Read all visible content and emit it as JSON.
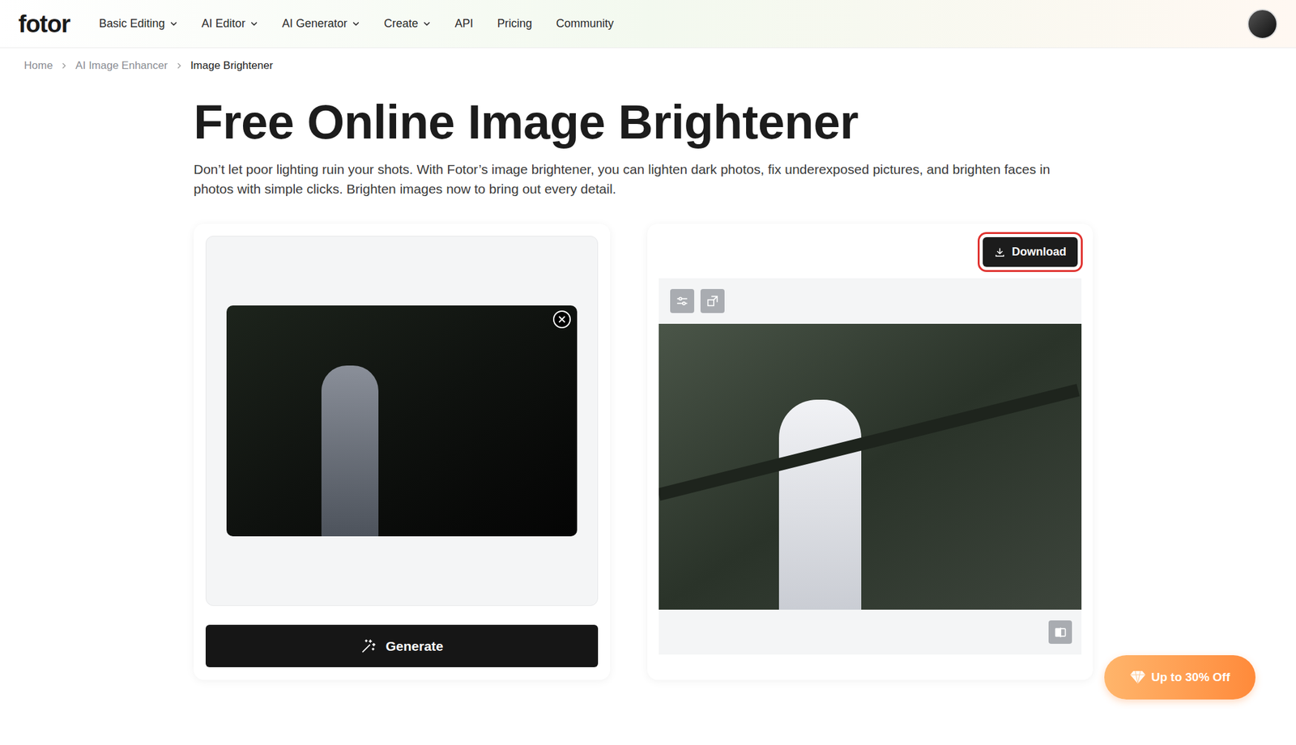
{
  "header": {
    "logo": "fotor",
    "nav": [
      {
        "label": "Basic Editing",
        "dropdown": true
      },
      {
        "label": "AI Editor",
        "dropdown": true
      },
      {
        "label": "AI Generator",
        "dropdown": true
      },
      {
        "label": "Create",
        "dropdown": true
      },
      {
        "label": "API",
        "dropdown": false
      },
      {
        "label": "Pricing",
        "dropdown": false
      },
      {
        "label": "Community",
        "dropdown": false
      }
    ]
  },
  "breadcrumb": [
    {
      "label": "Home",
      "current": false
    },
    {
      "label": "AI Image Enhancer",
      "current": false
    },
    {
      "label": "Image Brightener",
      "current": true
    }
  ],
  "title": "Free Online Image Brightener",
  "description": "Don’t let poor lighting ruin your shots. With Fotor’s image brightener, you can lighten dark photos, fix underexposed pictures, and brighten faces in photos with simple clicks. Brighten images now to bring out every detail.",
  "input": {
    "generate_label": "Generate"
  },
  "output": {
    "download": {
      "label": "Download",
      "highlighted": true
    }
  },
  "promo": {
    "label": "Up to 30% Off"
  }
}
